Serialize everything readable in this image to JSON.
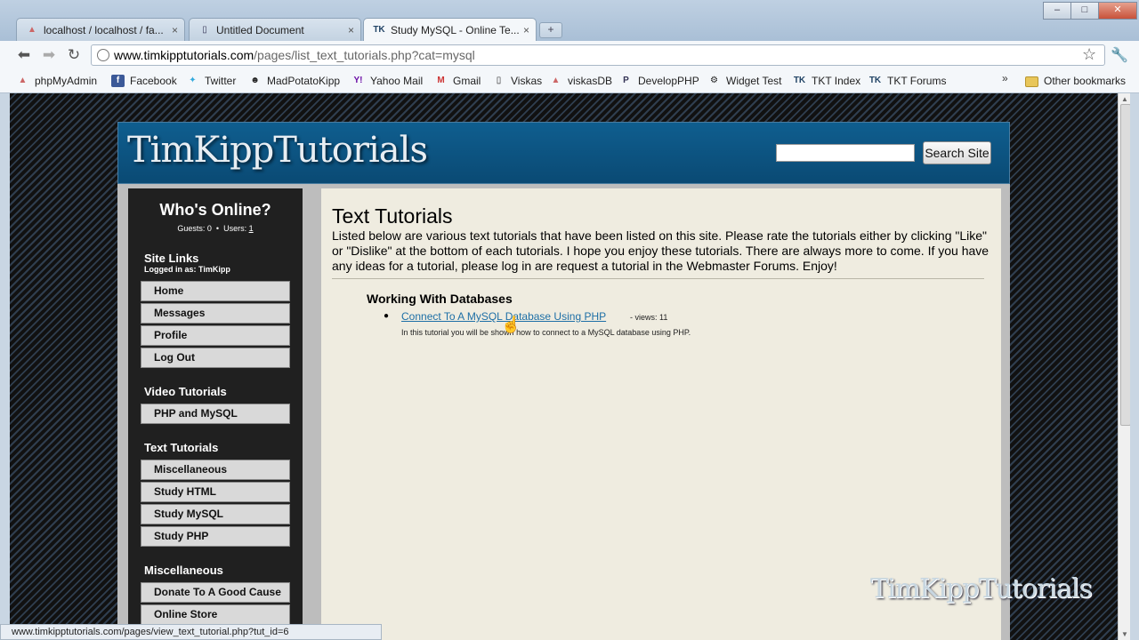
{
  "browser": {
    "tabs": [
      {
        "label": "localhost / localhost / fa...",
        "icon": "phpmyadmin-icon",
        "active": false
      },
      {
        "label": "Untitled Document",
        "icon": "page-icon",
        "active": false
      },
      {
        "label": "Study MySQL - Online Te...",
        "icon": "tk-icon",
        "active": true
      }
    ],
    "close_glyph": "×",
    "new_tab_glyph": "+",
    "window_buttons": {
      "minimize": "–",
      "maximize": "□",
      "close": "✕"
    },
    "url_domain": "www.timkipptutorials.com",
    "url_path": "/pages/list_text_tutorials.php?cat=mysql",
    "bookmarks": [
      {
        "label": "phpMyAdmin",
        "icon": "phpmyadmin-icon"
      },
      {
        "label": "Facebook",
        "icon": "facebook-icon"
      },
      {
        "label": "Twitter",
        "icon": "twitter-icon"
      },
      {
        "label": "MadPotatoKipp",
        "icon": "user-icon"
      },
      {
        "label": "Yahoo Mail",
        "icon": "yahoo-icon"
      },
      {
        "label": "Gmail",
        "icon": "gmail-icon"
      },
      {
        "label": "Viskas",
        "icon": "page-icon"
      },
      {
        "label": "viskasDB",
        "icon": "phpmyadmin-icon"
      },
      {
        "label": "DevelopPHP",
        "icon": "php-icon"
      },
      {
        "label": "Widget Test",
        "icon": "widget-icon"
      },
      {
        "label": "TKT Index",
        "icon": "tk-icon"
      },
      {
        "label": "TKT Forums",
        "icon": "tk-icon"
      }
    ],
    "bookmarks_more": "»",
    "other_bookmarks": "Other bookmarks",
    "status_url": "www.timkipptutorials.com/pages/view_text_tutorial.php?tut_id=6"
  },
  "site": {
    "logo": "TimKippTutorials",
    "search_button": "Search Site",
    "search_value": "",
    "sidebar": {
      "whos_online": "Who's Online?",
      "guests_label": "Guests: 0",
      "sep": "•",
      "users_label": "Users:",
      "users_count": "1",
      "site_links_title": "Site Links",
      "logged_in": "Logged in as: TimKipp",
      "site_links": [
        "Home",
        "Messages",
        "Profile",
        "Log Out"
      ],
      "video_title": "Video Tutorials",
      "video_links": [
        "PHP and MySQL"
      ],
      "text_title": "Text Tutorials",
      "text_links": [
        "Miscellaneous",
        "Study HTML",
        "Study MySQL",
        "Study PHP"
      ],
      "misc_title": "Miscellaneous",
      "misc_links": [
        "Donate To A Good Cause",
        "Online Store"
      ]
    },
    "main": {
      "title": "Text Tutorials",
      "intro": "Listed below are various text tutorials that have been listed on this site. Please rate the tutorials either by clicking \"Like\" or \"Dislike\" at the bottom of each tutorials. I hope you enjoy these tutorials. There are always more to come. If you have any ideas for a tutorial, please log in are request a tutorial in the Webmaster Forums. Enjoy!",
      "category": "Working With Databases",
      "tutorials": [
        {
          "title": "Connect To A MySQL Database Using PHP",
          "views": "- views: 11",
          "description": "In this tutorial you will be shown how to connect to a MySQL database using PHP."
        }
      ]
    }
  },
  "watermark": "TimKippTutorials"
}
